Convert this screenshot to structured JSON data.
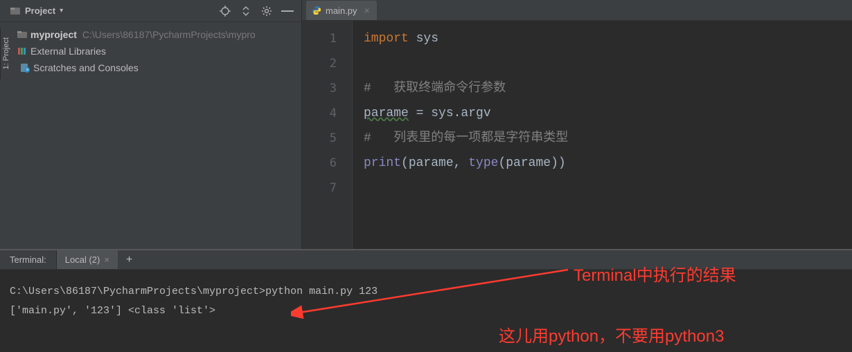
{
  "project_panel": {
    "title": "Project",
    "side_tab": "1: Project",
    "root": {
      "name": "myproject",
      "path": "C:\\Users\\86187\\PycharmProjects\\mypro"
    },
    "external_libraries": "External Libraries",
    "scratches": "Scratches and Consoles"
  },
  "editor": {
    "tab_name": "main.py",
    "lines": [
      "1",
      "2",
      "3",
      "4",
      "5",
      "6",
      "7"
    ],
    "code": {
      "l1_kw": "import",
      "l1_mod": " sys",
      "l3_comment": "#   获取终端命令行参数",
      "l4_var": "parame",
      "l4_rest": " = sys.argv",
      "l5_comment": "#   列表里的每一项都是字符串类型",
      "l6_print": "print",
      "l6_open": "(parame, ",
      "l6_type": "type",
      "l6_close": "(parame))"
    }
  },
  "terminal": {
    "panel_label": "Terminal:",
    "tab_label": "Local (2)",
    "prompt": "C:\\Users\\86187\\PycharmProjects\\myproject>",
    "command": "python main.py 123",
    "output": "['main.py', '123'] <class 'list'>"
  },
  "annotations": {
    "a1": "Terminal中执行的结果",
    "a2": "这儿用python，不要用python3"
  }
}
